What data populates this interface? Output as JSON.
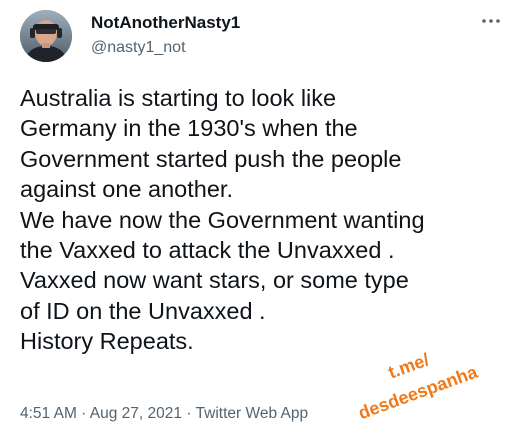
{
  "author": {
    "display_name": "NotAnotherNasty1",
    "handle": "@nasty1_not"
  },
  "tweet": {
    "lines": [
      "Australia is starting to look like",
      "Germany in the 1930's when the",
      "Government started push the people",
      "against one another.",
      "We have now the Government wanting",
      "the Vaxxed to attack the Unvaxxed .",
      "Vaxxed now want stars, or some type",
      "of ID on the Unvaxxed .",
      "History Repeats."
    ]
  },
  "meta": {
    "time": "4:51 AM",
    "date": "Aug 27, 2021",
    "source": "Twitter Web App",
    "separator": " · "
  },
  "watermark": {
    "line1": "t.me/",
    "line2": "desdeespanha",
    "color": "#f07a1a"
  },
  "colors": {
    "text": "#0f1419",
    "secondary": "#536471"
  },
  "icons": {
    "more": "more-horizontal-icon",
    "avatar": "avatar"
  }
}
